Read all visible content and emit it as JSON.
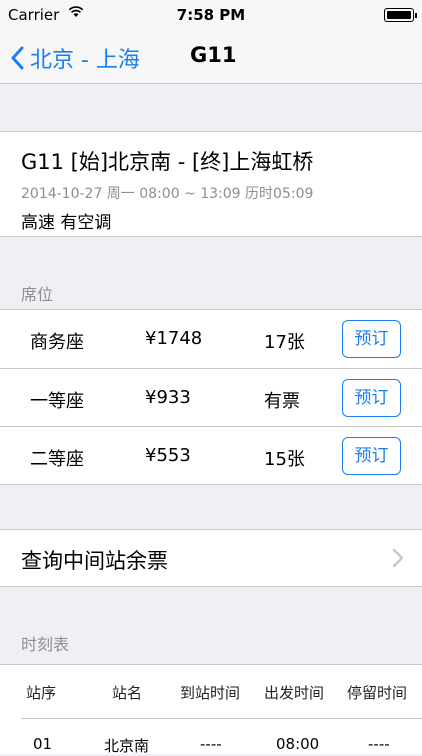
{
  "status": {
    "carrier": "Carrier",
    "time": "7:58 PM"
  },
  "nav": {
    "back_label": "北京 - 上海",
    "title": "G11"
  },
  "train": {
    "title": "G11 [始]北京南 - [终]上海虹桥",
    "schedule": "2014-10-27 周一 08:00 ~ 13:09 历时05:09",
    "type": "高速 有空调"
  },
  "seats_label": "席位",
  "seats": [
    {
      "name": "商务座",
      "price": "¥1748",
      "count": "17张",
      "button": "预订"
    },
    {
      "name": "一等座",
      "price": "¥933",
      "count": "有票",
      "button": "预订"
    },
    {
      "name": "二等座",
      "price": "¥553",
      "count": "15张",
      "button": "预订"
    }
  ],
  "query_label": "查询中间站余票",
  "timetable_label": "时刻表",
  "timetable": {
    "headers": [
      "站序",
      "站名",
      "到站时间",
      "出发时间",
      "停留时间"
    ],
    "rows": [
      [
        "01",
        "北京南",
        "----",
        "08:00",
        "----"
      ]
    ]
  },
  "colors": {
    "accent": "#1a7ef0",
    "background": "#efeff4",
    "secondary_text": "#8e8e93"
  }
}
